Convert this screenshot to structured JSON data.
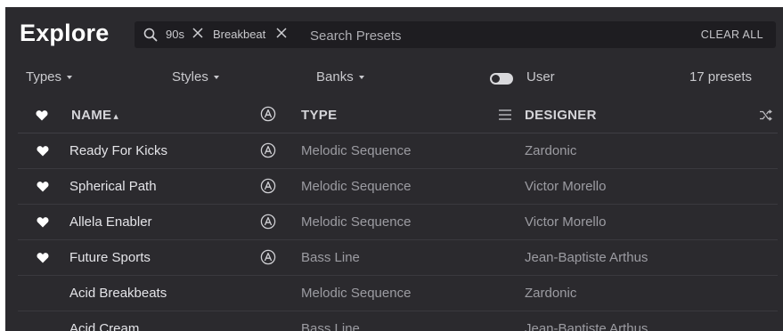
{
  "header": {
    "title": "Explore",
    "search": {
      "tags": [
        {
          "label": "90s"
        },
        {
          "label": "Breakbeat"
        }
      ],
      "placeholder": "Search Presets",
      "clear_label": "CLEAR ALL"
    }
  },
  "filters": {
    "types_label": "Types",
    "styles_label": "Styles",
    "banks_label": "Banks",
    "user_label": "User",
    "user_toggle_on": false,
    "count_label": "17 presets"
  },
  "columns": {
    "name": "NAME",
    "type": "TYPE",
    "designer": "DESIGNER",
    "sort_indicator": "▴"
  },
  "icons": {
    "favorite": "heart-icon",
    "factory": "arturia-logo-icon",
    "shuffle": "shuffle-icon",
    "menu": "hamburger-icon",
    "search": "search-icon"
  },
  "colors": {
    "background": "#2b2a2e",
    "searchbar": "#1e1d21",
    "text_primary": "#e4e4e8",
    "text_secondary": "#9c9ca2"
  },
  "presets": [
    {
      "name": "Ready For Kicks",
      "type": "Melodic Sequence",
      "designer": "Zardonic",
      "favorite": true,
      "factory": true
    },
    {
      "name": "Spherical Path",
      "type": "Melodic Sequence",
      "designer": "Victor Morello",
      "favorite": true,
      "factory": true
    },
    {
      "name": "Allela Enabler",
      "type": "Melodic Sequence",
      "designer": "Victor Morello",
      "favorite": true,
      "factory": true
    },
    {
      "name": "Future Sports",
      "type": "Bass Line",
      "designer": "Jean-Baptiste Arthus",
      "favorite": true,
      "factory": true
    },
    {
      "name": "Acid Breakbeats",
      "type": "Melodic Sequence",
      "designer": "Zardonic",
      "favorite": false,
      "factory": false
    },
    {
      "name": "Acid Cream",
      "type": "Bass Line",
      "designer": "Jean-Baptiste Arthus",
      "favorite": false,
      "factory": false
    }
  ]
}
